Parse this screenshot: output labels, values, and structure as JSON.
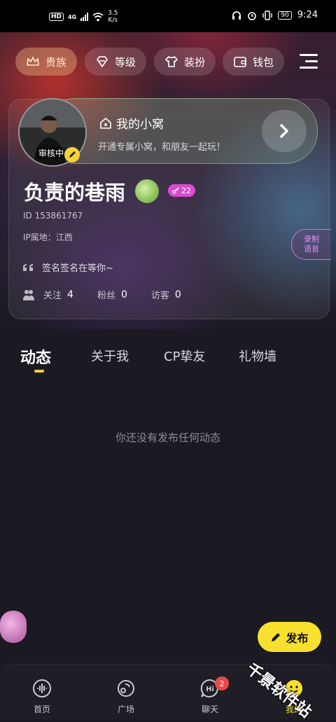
{
  "status_bar": {
    "hd": "HD",
    "network": "4G",
    "speed_value": "3.5",
    "speed_unit": "K/s",
    "battery": "90",
    "time": "9:24"
  },
  "top_chips": [
    {
      "label": "贵族",
      "icon": "crown-icon"
    },
    {
      "label": "等级",
      "icon": "gem-icon"
    },
    {
      "label": "装扮",
      "icon": "shirt-icon"
    },
    {
      "label": "钱包",
      "icon": "wallet-icon"
    }
  ],
  "nest": {
    "title": "我的小窝",
    "subtitle": "开通专属小窝，和朋友一起玩！"
  },
  "profile": {
    "avatar_status": "审核中",
    "nickname": "负责的巷雨",
    "level": "22",
    "id_text": "ID  153861767",
    "ip_text": "IP属地：江西",
    "signature": "签名签名在等你~",
    "following_label": "关注",
    "following_count": "4",
    "fans_label": "粉丝",
    "fans_count": "0",
    "visitors_label": "访客",
    "visitors_count": "0",
    "voice_line1": "录制",
    "voice_line2": "语音"
  },
  "tabs": [
    "动态",
    "关于我",
    "CP挚友",
    "礼物墙"
  ],
  "empty_text": "你还没有发布任何动态",
  "publish_label": "发布",
  "bottom_nav": [
    {
      "label": "首页",
      "icon": "home-wave-icon"
    },
    {
      "label": "广场",
      "icon": "planet-icon"
    },
    {
      "label": "聊天",
      "icon": "chat-hi-icon",
      "badge": "2"
    },
    {
      "label": "我的",
      "icon": "profile-face-icon"
    }
  ],
  "watermark": "千景软件站",
  "colors": {
    "accent_yellow": "#f7e02e",
    "level_pink": "#d84cd0",
    "badge_red": "#e94848",
    "background": "#1b1a22"
  }
}
